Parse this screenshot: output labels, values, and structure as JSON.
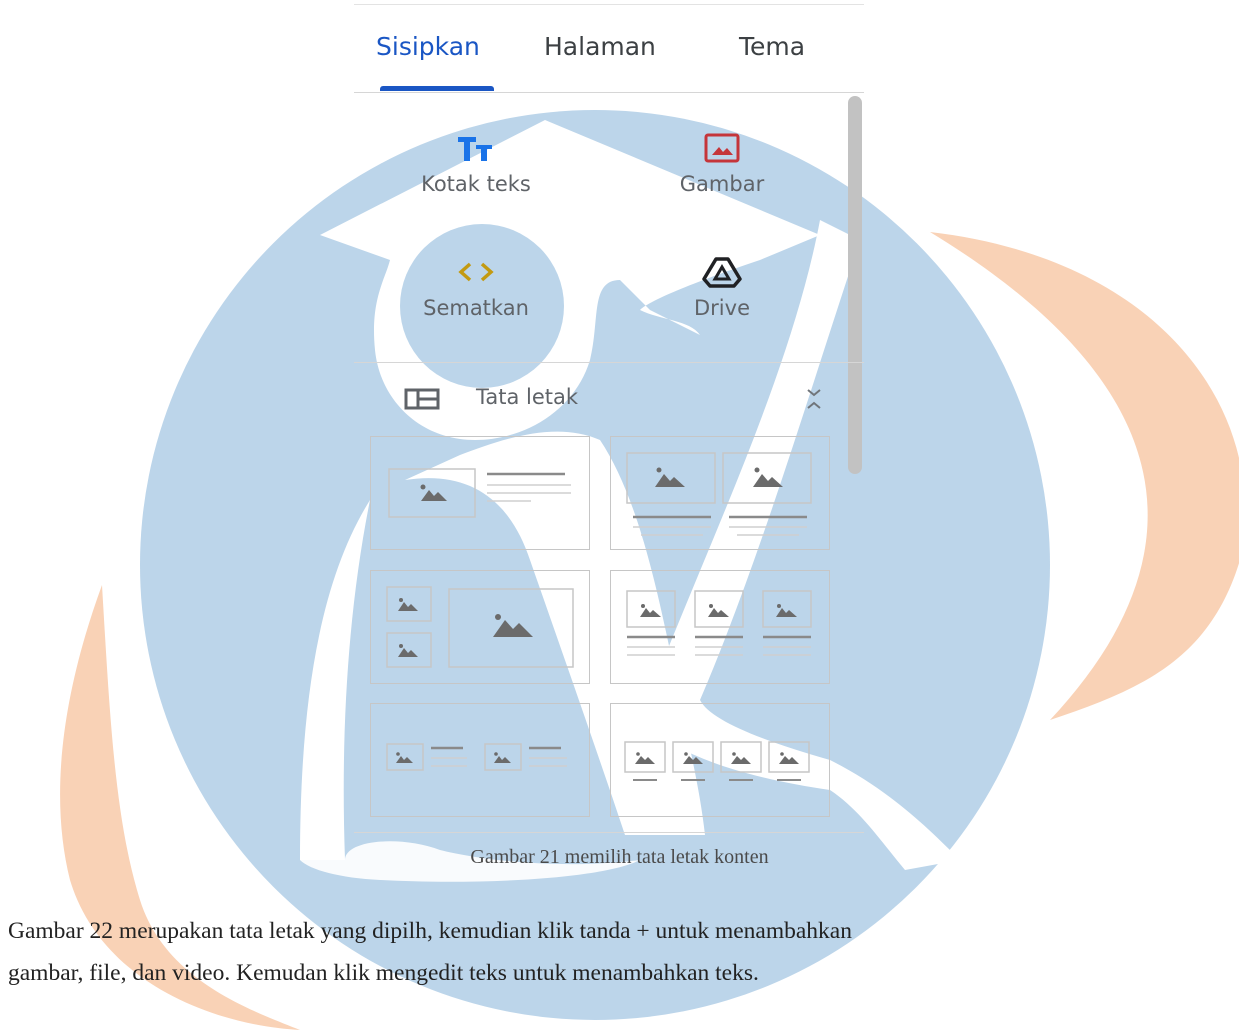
{
  "tabs": [
    {
      "label": "Sisipkan",
      "active": true
    },
    {
      "label": "Halaman",
      "active": false
    },
    {
      "label": "Tema",
      "active": false
    }
  ],
  "insert_items": [
    {
      "label": "Kotak teks",
      "icon": "text-box-icon"
    },
    {
      "label": "Gambar",
      "icon": "image-icon"
    },
    {
      "label": "Sematkan",
      "icon": "embed-code-icon"
    },
    {
      "label": "Drive",
      "icon": "drive-icon"
    }
  ],
  "layouts_section": {
    "label": "Tata letak",
    "layout_count": 6
  },
  "caption": "Gambar 21 memilih tata letak konten",
  "paragraph": {
    "line1": "Gambar 22 merupakan tata letak yang dipilh, kemudian klik tanda + untuk menambahkan",
    "line2": "gambar, file, dan video. Kemudan klik mengedit teks untuk menambahkan teks."
  },
  "colors": {
    "accent": "#1a56c4",
    "image_icon": "#c5353a",
    "embed_icon": "#c39a11",
    "watermark_blue": "#bad4ea",
    "watermark_orange": "#f8d0b3"
  }
}
